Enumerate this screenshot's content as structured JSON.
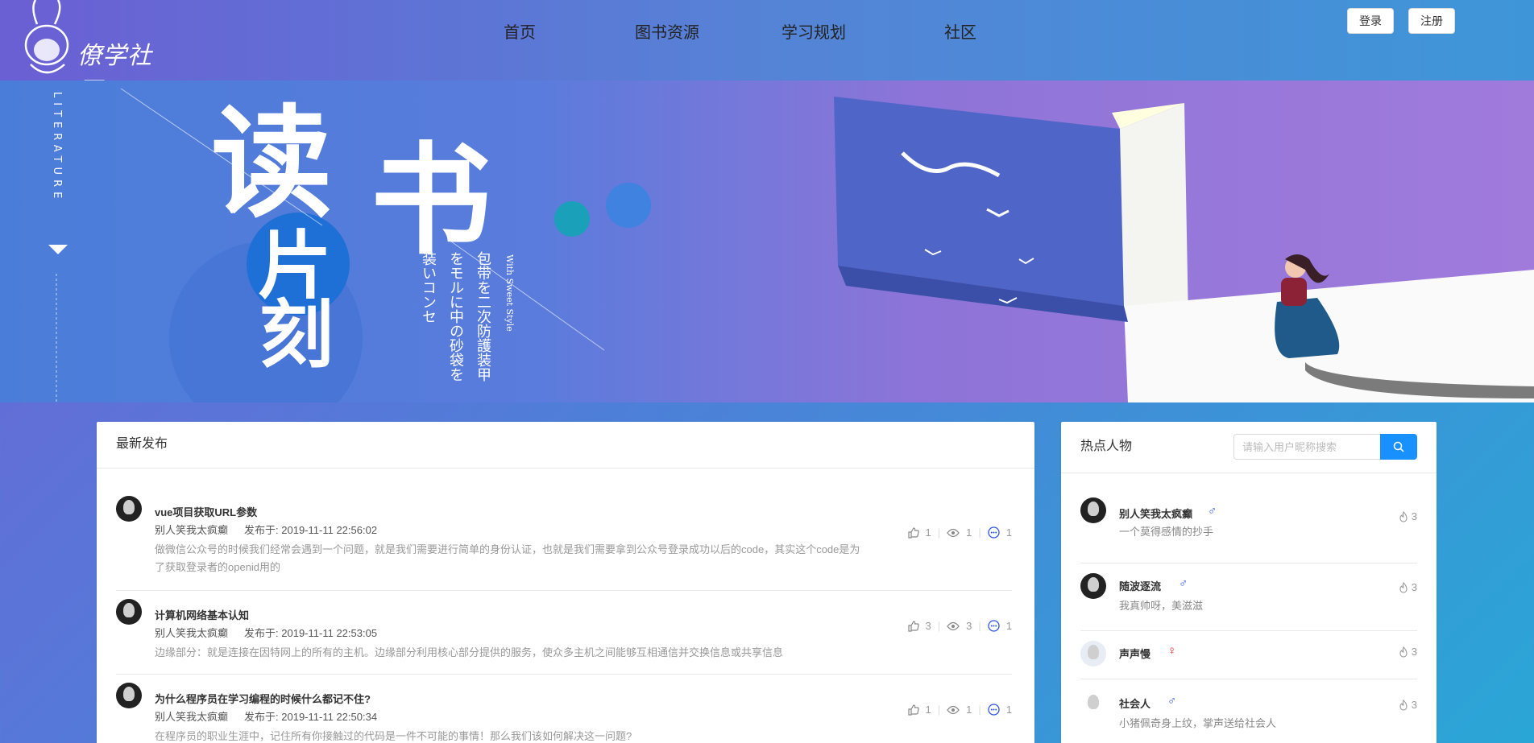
{
  "header": {
    "logo_text": "僚学社区",
    "nav": [
      "首页",
      "图书资源",
      "学习规划",
      "社区"
    ],
    "login_label": "登录",
    "register_label": "注册"
  },
  "banner": {
    "vertical_word": "LITERATURE",
    "title_chars": [
      "读",
      "书",
      "片",
      "刻"
    ],
    "jp_line1": "包带を二次防護装甲",
    "jp_line2": "をモルに中の砂袋を",
    "jp_line3": "装いコンセ",
    "with_sweet": "With Sweet Style"
  },
  "feed": {
    "title": "最新发布",
    "meta_prefix": "发布于:",
    "posts": [
      {
        "title": "vue项目获取URL参数",
        "author": "别人笑我太疯癫",
        "time": "2019-11-11 22:56:02",
        "desc": "做微信公众号的时候我们经常会遇到一个问题，就是我们需要进行简单的身份认证，也就是我们需要拿到公众号登录成功以后的code，其实这个code是为了获取登录者的openid用的",
        "likes": "1",
        "views": "1",
        "comments": "1"
      },
      {
        "title": "计算机网络基本认知",
        "author": "别人笑我太疯癫",
        "time": "2019-11-11 22:53:05",
        "desc": "边缘部分：就是连接在因特网上的所有的主机。边缘部分利用核心部分提供的服务，使众多主机之间能够互相通信并交换信息或共享信息",
        "likes": "3",
        "views": "3",
        "comments": "1"
      },
      {
        "title": "为什么程序员在学习编程的时候什么都记不住?",
        "author": "别人笑我太疯癫",
        "time": "2019-11-11 22:50:34",
        "desc": "在程序员的职业生涯中，记住所有你接触过的代码是一件不可能的事情！那么我们该如何解决这一问题?",
        "likes": "1",
        "views": "1",
        "comments": "1"
      }
    ]
  },
  "hot": {
    "title": "热点人物",
    "search_placeholder": "请输入用户昵称搜索",
    "people": [
      {
        "name": "别人笑我太疯癫",
        "gender": "♂",
        "sign": "一个莫得感情的抄手",
        "heat": "3",
        "gender_color": "#2f54eb"
      },
      {
        "name": "随波逐流",
        "gender": "♂",
        "sign": "我真帅呀，美滋滋",
        "heat": "3",
        "gender_color": "#2f54eb"
      },
      {
        "name": "声声慢",
        "gender": "♀",
        "sign": "",
        "heat": "3",
        "gender_color": "#f5222d"
      },
      {
        "name": "社会人",
        "gender": "♂",
        "sign": "小猪佩奇身上纹，掌声送给社会人",
        "heat": "3",
        "gender_color": "#2f54eb"
      }
    ]
  },
  "colors": {
    "primary": "#1890ff",
    "male": "#2f54eb",
    "female": "#f5222d"
  }
}
